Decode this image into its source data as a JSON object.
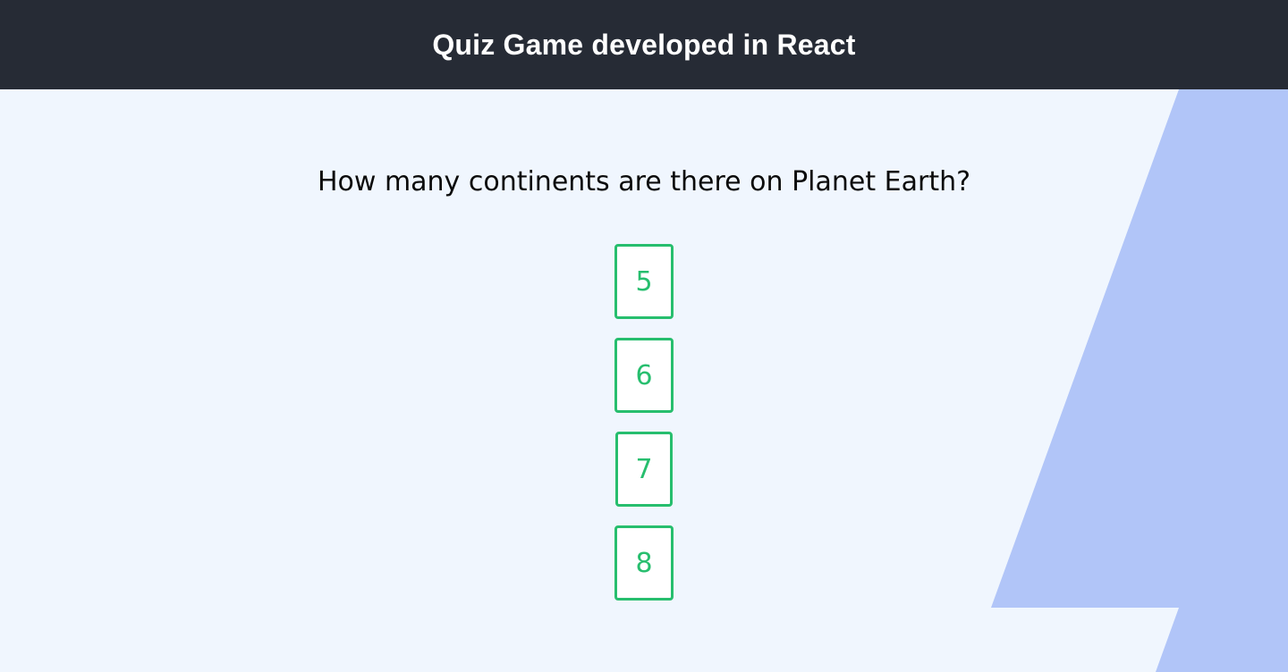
{
  "header": {
    "title": "Quiz Game developed in React"
  },
  "quiz": {
    "question": "How many continents are there on Planet Earth?",
    "answers": [
      {
        "label": "5"
      },
      {
        "label": "6"
      },
      {
        "label": "7"
      },
      {
        "label": "8"
      }
    ]
  },
  "colors": {
    "header_background": "#262b35",
    "page_background": "#f0f6fe",
    "decorative_shape": "#b1c5f8",
    "answer_accent": "#27be6e"
  }
}
